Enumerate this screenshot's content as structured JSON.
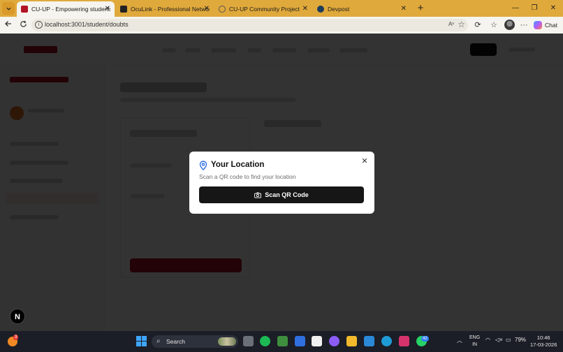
{
  "browser": {
    "tabs": [
      {
        "title": "CU-UP - Empowering students at t",
        "active": true,
        "favicon_color": "#b11226"
      },
      {
        "title": "OcuLink - Professional Networking",
        "active": false,
        "favicon_color": "#222222"
      },
      {
        "title": "CU-UP Community Project",
        "active": false,
        "favicon_color": "#555555"
      },
      {
        "title": "Devpost",
        "active": false,
        "favicon_color": "#1f3d5c"
      }
    ],
    "address": "localhost:3001/student/doubts",
    "chat_label": "Chat"
  },
  "modal": {
    "title": "Your Location",
    "description": "Scan a QR code to find your location",
    "button_label": "Scan QR Code"
  },
  "nextjs_badge": "N",
  "taskbar": {
    "search_label": "Search",
    "notification_count": "3",
    "whatsapp_count": "42",
    "language_line1": "ENG",
    "language_line2": "IN",
    "battery": "79%",
    "time": "10:46",
    "date": "17-03-2026"
  },
  "colors": {
    "tabbar": "#e0a93b",
    "brand_red": "#b11226",
    "modal_button": "#161616"
  }
}
